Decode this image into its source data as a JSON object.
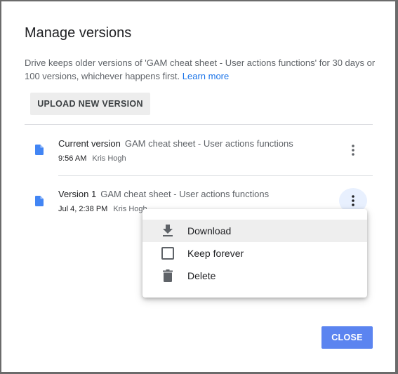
{
  "dialog": {
    "title": "Manage versions",
    "description": "Drive keeps older versions of 'GAM cheat sheet - User actions functions' for 30 days or 100 versions, whichever happens first.",
    "learn_more": "Learn more",
    "upload_label": "UPLOAD NEW VERSION",
    "close_label": "CLOSE"
  },
  "versions": [
    {
      "label": "Current version",
      "name": "GAM cheat sheet - User actions functions",
      "time": "9:56 AM",
      "author": "Kris Hogh"
    },
    {
      "label": "Version 1",
      "name": "GAM cheat sheet - User actions functions",
      "time": "Jul 4, 2:38 PM",
      "author": "Kris Hogh"
    }
  ],
  "menu": {
    "items": [
      {
        "label": "Download",
        "icon": "download-icon"
      },
      {
        "label": "Keep forever",
        "icon": "checkbox-icon"
      },
      {
        "label": "Delete",
        "icon": "trash-icon"
      }
    ]
  },
  "colors": {
    "accent": "#1a73e8",
    "close_button": "#5b84f0",
    "file_icon": "#4285f4"
  }
}
